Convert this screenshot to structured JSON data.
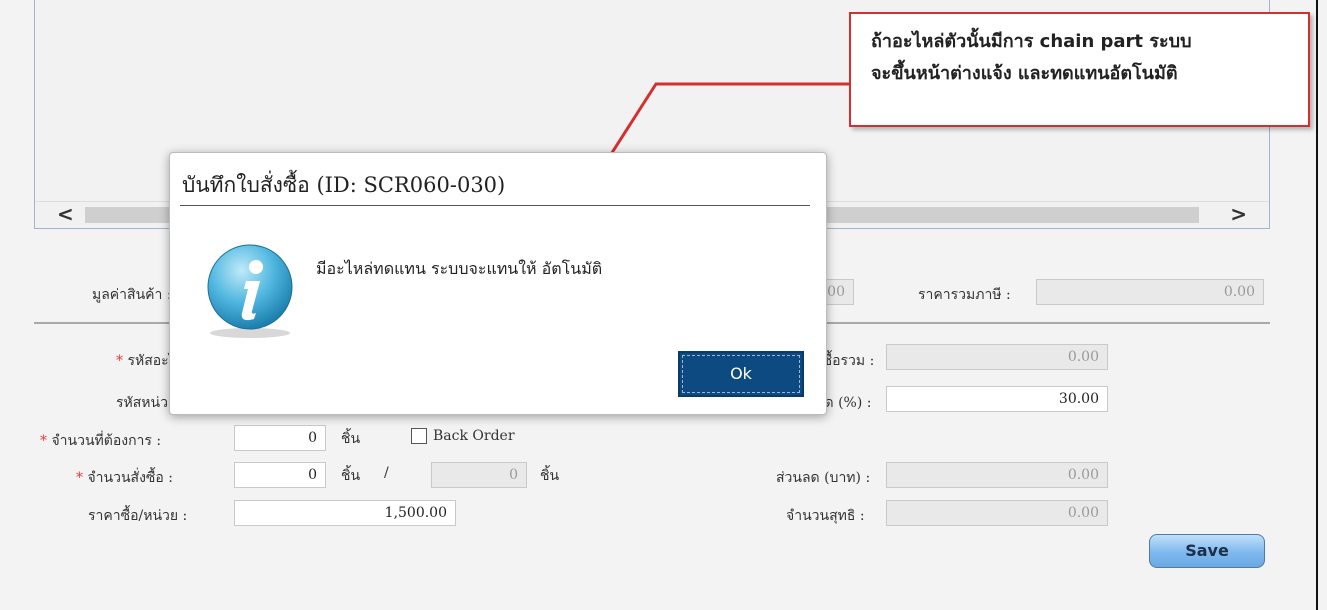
{
  "grid": {
    "scroll_left": "<",
    "scroll_right": ">"
  },
  "summary": {
    "goods_value_label": "มูลค่าสินค้า :",
    "goods_value": "0.00",
    "total_tax_label": "ราคารวมภาษี :",
    "total_tax_value": "0.00"
  },
  "form": {
    "part_code_label": "รหัสอะไหล่ :",
    "unit_code_label": "รหัสหน่วยซื้อ :",
    "qty_needed_label": "จำนวนที่ต้องการ :",
    "qty_needed_value": "0",
    "qty_needed_unit": "ชิ้น",
    "back_order_label": "Back Order",
    "qty_order_label": "จำนวนสั่งซื้อ :",
    "qty_order_value": "0",
    "qty_order_unit": "ชิ้น",
    "qty_slash": "/",
    "qty_order_secondary_value": "0",
    "qty_order_secondary_unit": "ชิ้น",
    "unit_price_label": "ราคาซื้อ/หน่วย :",
    "unit_price_value": "1,500.00",
    "total_price_label": "ราคาซื้อรวม :",
    "total_price_value": "0.00",
    "discount_pct_label": "ส่วนลด (%) :",
    "discount_pct_value": "30.00",
    "discount_baht_label": "ส่วนลด (บาท) :",
    "discount_baht_value": "0.00",
    "net_amount_label": "จำนวนสุทธิ :",
    "net_amount_value": "0.00",
    "required_mark": "*",
    "save_label": "Save"
  },
  "dialog": {
    "title": "บันทึกใบสั่งซื้อ (ID: SCR060-030)",
    "message": "มีอะไหล่ทดแทน ระบบจะแทนให้ อัตโนมัติ",
    "ok_label": "Ok",
    "icon": "info-icon"
  },
  "callout": {
    "line1": "ถ้าอะไหล่ตัวนั้นมีการ chain part ระบบ",
    "line2": "จะขึ้นหน้าต่างแจ้ง และทดแทนอัตโนมัติ",
    "border_color": "#d32f2f"
  },
  "colors": {
    "ok_button": "#0d4a82",
    "required": "#e53935",
    "save_button": "#7fb8ee"
  }
}
